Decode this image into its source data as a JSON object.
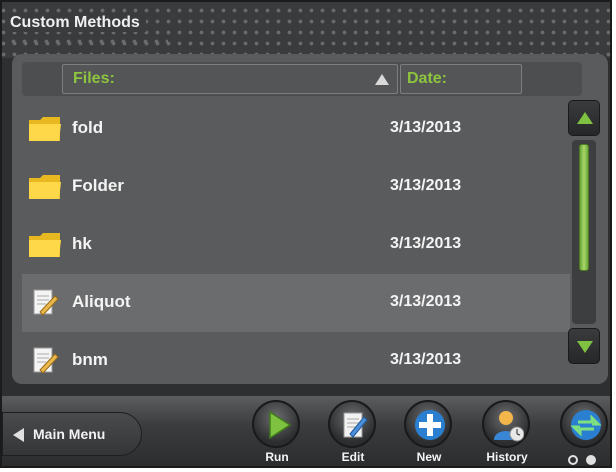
{
  "window": {
    "title": "Custom Methods"
  },
  "table": {
    "columns": [
      "Files:",
      "Date:"
    ],
    "sort_icon": "sort-ascending-icon",
    "rows": [
      {
        "icon": "folder-icon",
        "name": "fold",
        "date": "3/13/2013",
        "selected": false
      },
      {
        "icon": "folder-icon",
        "name": "Folder",
        "date": "3/13/2013",
        "selected": false
      },
      {
        "icon": "folder-icon",
        "name": "hk",
        "date": "3/13/2013",
        "selected": false
      },
      {
        "icon": "method-file-icon",
        "name": "Aliquot",
        "date": "3/13/2013",
        "selected": true
      },
      {
        "icon": "method-file-icon",
        "name": "bnm",
        "date": "3/13/2013",
        "selected": false
      }
    ]
  },
  "scrollbar": {
    "up_icon": "scroll-up-icon",
    "down_icon": "scroll-down-icon",
    "position": 0.0,
    "visible_fraction": 0.72
  },
  "toolbar": {
    "main_menu_label": "Main Menu",
    "run_label": "Run",
    "edit_label": "Edit",
    "new_label": "New",
    "history_label": "History"
  },
  "pager": {
    "pages": 2,
    "current": 2
  },
  "colors": {
    "accent_green": "#8dc53e",
    "panel": "#5a5b5d",
    "background": "#2e2f31",
    "blue_button": "#2a7fd0"
  }
}
